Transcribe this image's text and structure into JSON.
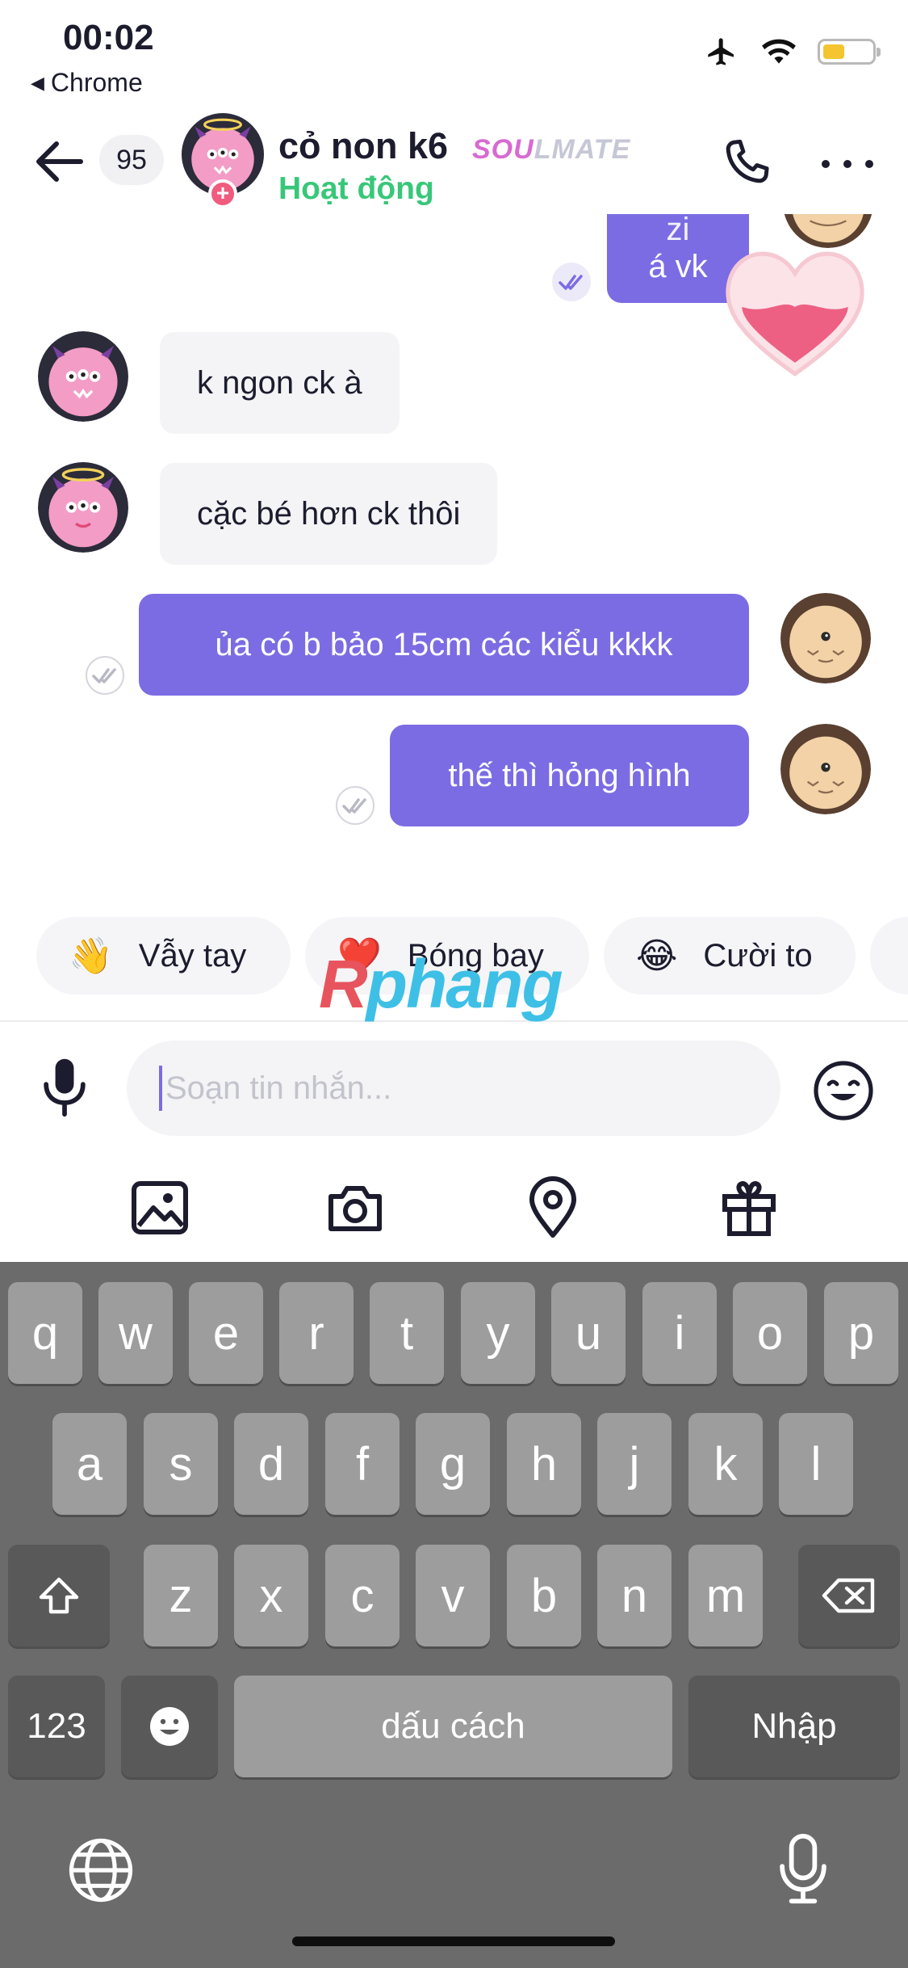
{
  "status_bar": {
    "time": "00:02",
    "back_app": "Chrome"
  },
  "header": {
    "unread_count": "95",
    "contact_name": "cỏ non k6",
    "badge_part1": "SOU",
    "badge_part2": "LMATE",
    "presence": "Hoạt động"
  },
  "messages": [
    {
      "direction": "out",
      "text_line1": "zi",
      "text_line2": "á vk"
    },
    {
      "direction": "in",
      "text": "k ngon ck à"
    },
    {
      "direction": "in",
      "text": "cặc bé hơn ck thôi"
    },
    {
      "direction": "out",
      "text": "ủa có b bảo 15cm các kiểu kkkk"
    },
    {
      "direction": "out",
      "text": "thế thì hỏng hình"
    }
  ],
  "quick_replies": [
    {
      "emoji": "👋",
      "label": "Vẫy tay"
    },
    {
      "emoji": "❤️",
      "label": "Bóng bay"
    },
    {
      "emoji": "😂",
      "label": "Cười to"
    }
  ],
  "watermark": {
    "part1": "R",
    "part2": "phang"
  },
  "composer": {
    "placeholder": "Soạn tin nhắn..."
  },
  "toolbar": [
    "image-icon",
    "camera-icon",
    "location-icon",
    "gift-icon"
  ],
  "keyboard": {
    "row1": [
      "q",
      "w",
      "e",
      "r",
      "t",
      "y",
      "u",
      "i",
      "o",
      "p"
    ],
    "row2": [
      "a",
      "s",
      "d",
      "f",
      "g",
      "h",
      "j",
      "k",
      "l"
    ],
    "row3": [
      "z",
      "x",
      "c",
      "v",
      "b",
      "n",
      "m"
    ],
    "numbers_key": "123",
    "space_key": "dấu cách",
    "return_key": "Nhập"
  },
  "colors": {
    "accent": "#7b6ce4",
    "online": "#38c779",
    "incoming_bubble": "#f4f4f6",
    "keyboard_bg": "#6b6b6b"
  }
}
